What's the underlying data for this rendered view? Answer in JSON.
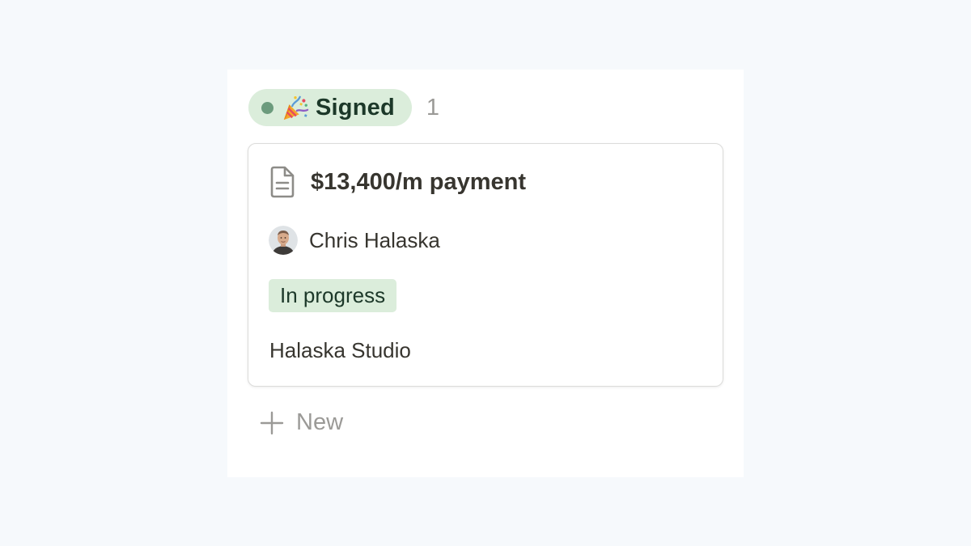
{
  "board_group": {
    "status": {
      "label": "Signed",
      "emoji_icon": "party-popper-icon",
      "dot_color": "#6c9b7d",
      "pill_color": "#dbeddb"
    },
    "count": "1"
  },
  "card": {
    "icon": "document-icon",
    "title": "$13,400/m payment",
    "assignee": {
      "name": "Chris Halaska",
      "avatar_icon": "avatar"
    },
    "status_tag": "In progress",
    "company": "Halaska Studio"
  },
  "new_button": {
    "icon": "plus-icon",
    "label": "New"
  }
}
